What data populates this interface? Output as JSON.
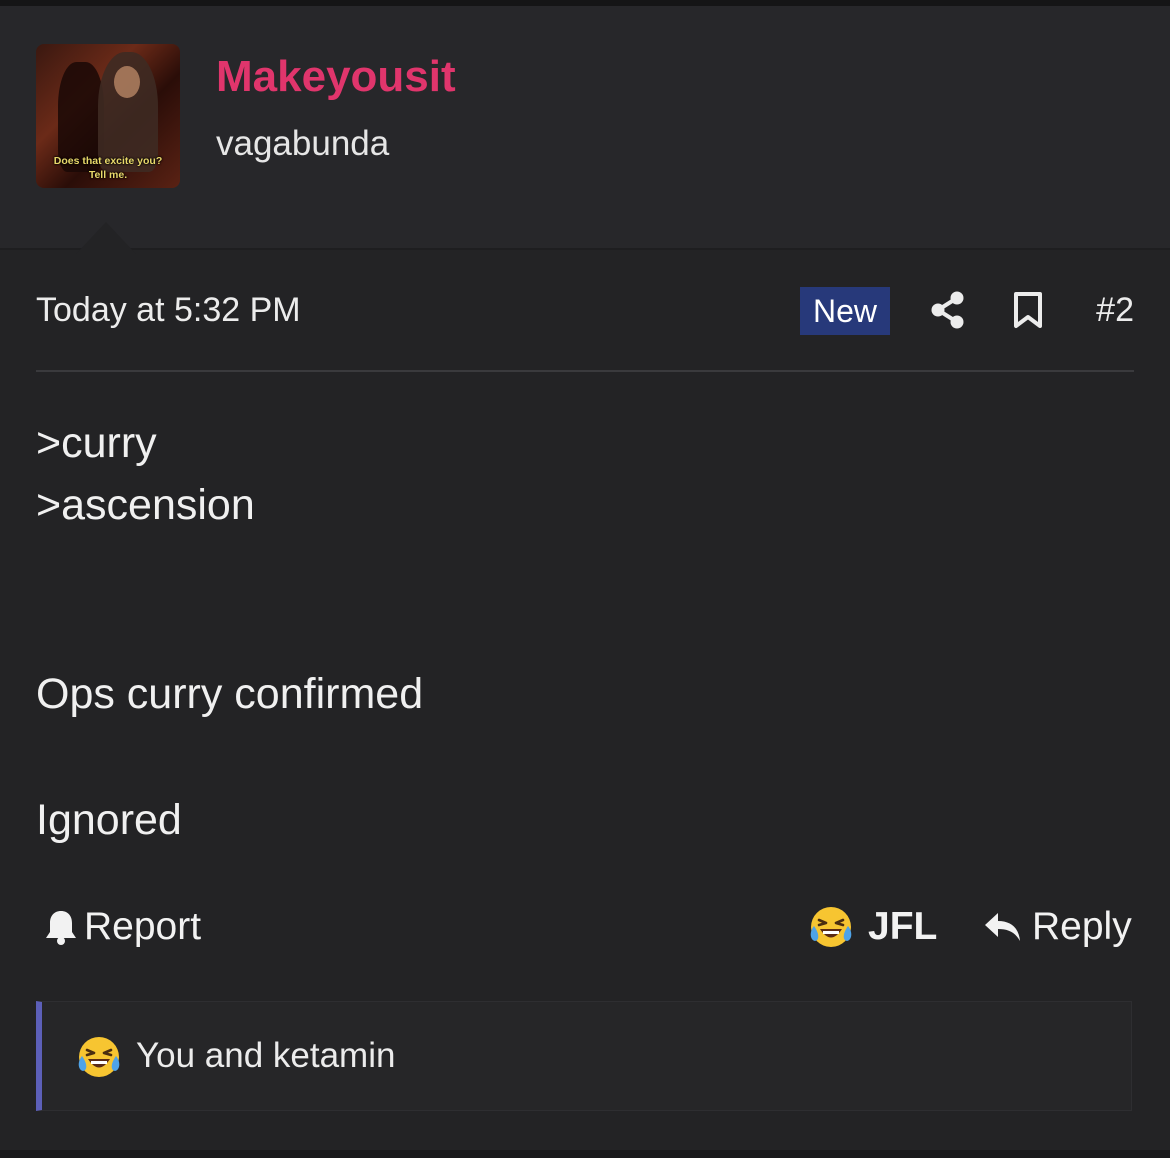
{
  "author": {
    "username": "Makeyousit",
    "user_title": "vagabunda",
    "avatar_caption": [
      "Does that excite you?",
      "Tell me."
    ]
  },
  "post": {
    "date": "Today at 5:32 PM",
    "badge": "New",
    "number": "#2",
    "body": [
      ">curry",
      ">ascension",
      "Ops curry confirmed",
      "Ignored"
    ]
  },
  "actions": {
    "report_label": "Report",
    "reaction_label": "JFL",
    "reply_label": "Reply"
  },
  "reactions_summary": {
    "text": "You and ketamin"
  },
  "colors": {
    "background": "#232325",
    "username": "#e0356c",
    "new_badge": "#27397a",
    "reaction_accent": "#5c5fb8"
  },
  "icons": [
    "bell-icon",
    "laughing-tears-emoji-icon",
    "reply-arrow-icon",
    "share-icon",
    "bookmark-icon"
  ]
}
